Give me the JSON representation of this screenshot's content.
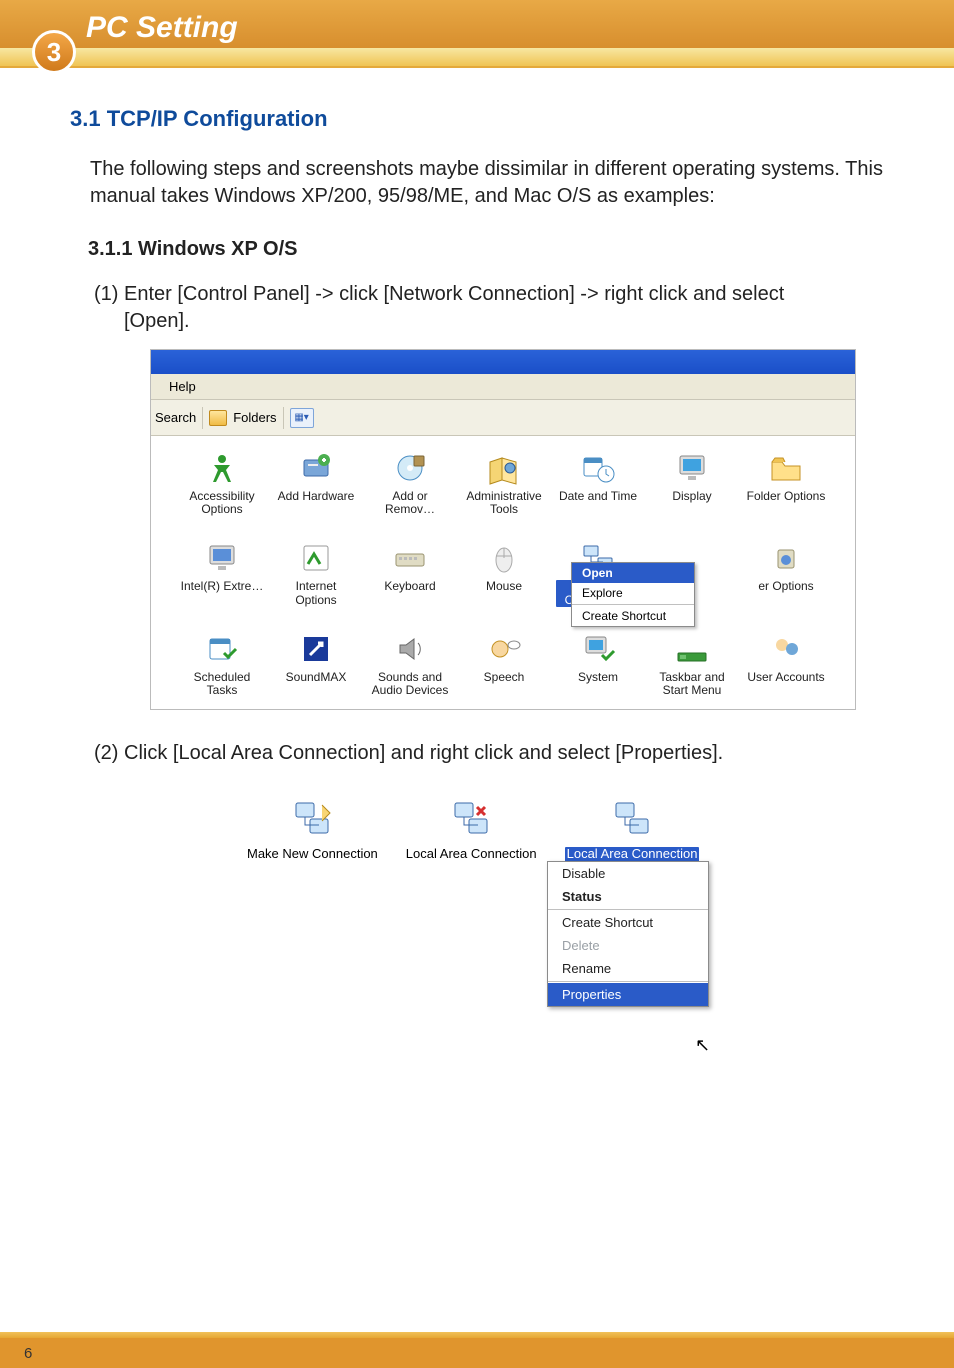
{
  "header": {
    "section_number": "3",
    "title": "PC Setting"
  },
  "headings": {
    "h31": "3.1 TCP/IP Configuration",
    "intro": "The following steps and screenshots maybe dissimilar in  different operating systems. This manual takes Windows XP/200, 95/98/ME, and Mac O/S as examples:",
    "h311": "3.1.1 Windows XP O/S",
    "step1_lead": "(1) Enter [Control Panel] -> click [Network Connection] -> right click and select",
    "step1_cont": "[Open].",
    "step2": "(2) Click [Local Area Connection] and right click and select [Properties]."
  },
  "shot1": {
    "menu_help": "Help",
    "tb_search": "Search",
    "tb_folders": "Folders",
    "ctx": {
      "open": "Open",
      "explore": "Explore",
      "create_shortcut": "Create Shortcut"
    },
    "items": [
      "Accessibility Options",
      "Add Hardware",
      "Add or Remov…",
      "Administrative Tools",
      "Date and Time",
      "Display",
      "Folder Options",
      "Intel(R) Extre…",
      "Internet Options",
      "Keyboard",
      "Mouse",
      "Network Connections",
      "",
      "er Options",
      "Scheduled Tasks",
      "SoundMAX",
      "Sounds and Audio Devices",
      "Speech",
      "System",
      "Taskbar and Start Menu",
      "User Accounts"
    ]
  },
  "shot2": {
    "items": [
      {
        "label": "Make New Connection"
      },
      {
        "label": "Local Area Connection"
      },
      {
        "label": "Local Area Connection",
        "selected": true
      }
    ],
    "ctx": {
      "disable": "Disable",
      "status": "Status",
      "create_shortcut": "Create Shortcut",
      "delete": "Delete",
      "rename": "Rename",
      "properties": "Properties"
    }
  },
  "footer": {
    "page": "6"
  }
}
